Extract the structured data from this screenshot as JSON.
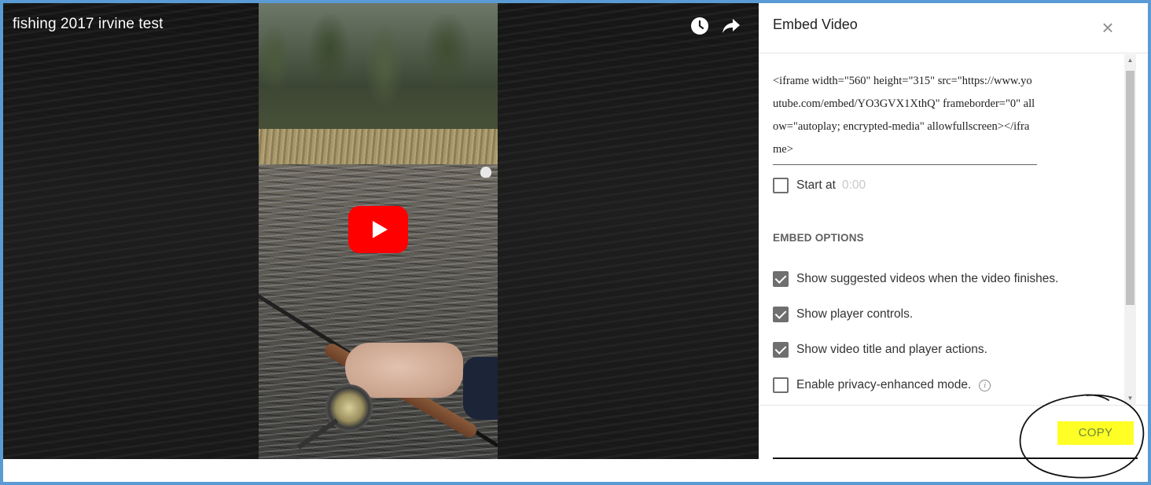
{
  "video": {
    "title": "fishing 2017 irvine test",
    "icons": {
      "watch_later": "watch-later-icon",
      "share": "share-icon",
      "play": "play-icon"
    },
    "play_color": "#ff0000"
  },
  "embed_panel": {
    "title": "Embed Video",
    "close_label": "×",
    "embed_code": "<iframe width=\"560\" height=\"315\" src=\"https://www.youtube.com/embed/YO3GVX1XthQ\" frameborder=\"0\" allow=\"autoplay; encrypted-media\" allowfullscreen></iframe>",
    "start_at": {
      "label": "Start at",
      "value": "0:00",
      "checked": false
    },
    "section_heading": "EMBED OPTIONS",
    "options": [
      {
        "label": "Show suggested videos when the video finishes.",
        "checked": true
      },
      {
        "label": "Show player controls.",
        "checked": true
      },
      {
        "label": "Show video title and player actions.",
        "checked": true
      },
      {
        "label": "Enable privacy-enhanced mode.",
        "checked": false
      }
    ],
    "info_icon": "i",
    "copy_label": "COPY"
  },
  "annotations": {
    "highlight_color": "#ffff26",
    "circle_color": "#111111",
    "frame_border_color": "#5b9bd5"
  }
}
